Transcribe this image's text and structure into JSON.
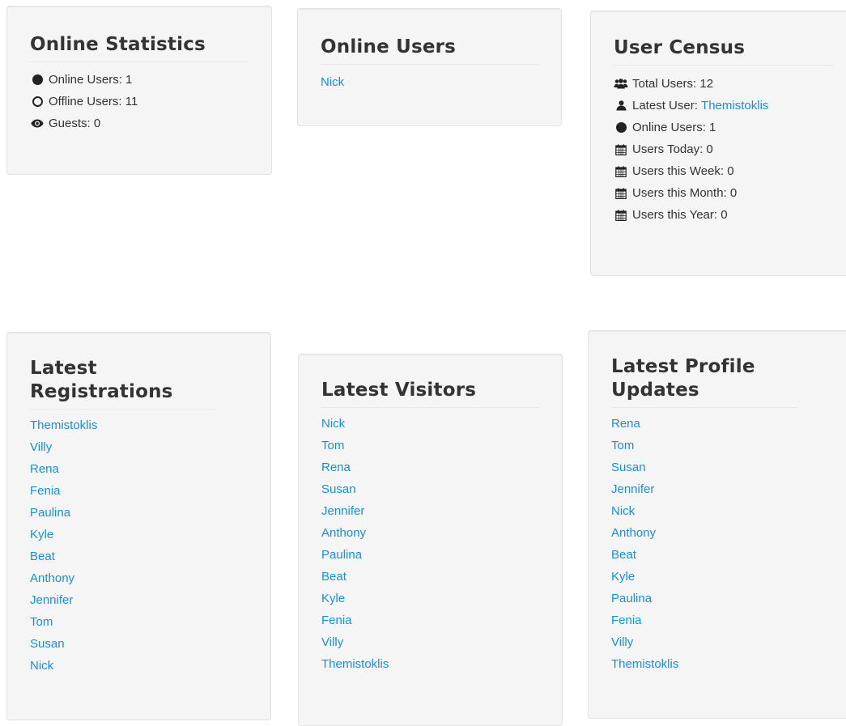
{
  "colors": {
    "link": "#1a8fd0",
    "panel_bg": "#f5f5f5",
    "panel_border": "#e3e3e3",
    "text": "#333333"
  },
  "online_statistics": {
    "title": "Online Statistics",
    "rows": [
      {
        "icon": "filled-circle-icon",
        "text": "Online Users: 1"
      },
      {
        "icon": "open-circle-icon",
        "text": "Offline Users: 11"
      },
      {
        "icon": "eye-icon",
        "text": "Guests: 0"
      }
    ]
  },
  "online_users": {
    "title": "Online Users",
    "users": [
      "Nick"
    ]
  },
  "user_census": {
    "title": "User Census",
    "total_users": "Total Users: 12",
    "latest_user_label": "Latest User: ",
    "latest_user_name": "Themistoklis",
    "online_users": "Online Users: 1",
    "users_today": "Users Today: 0",
    "users_week": "Users this Week: 0",
    "users_month": "Users this Month: 0",
    "users_year": "Users this Year: 0",
    "icons": [
      "users-icon",
      "user-icon",
      "filled-circle-icon",
      "calendar-icon"
    ]
  },
  "latest_registrations": {
    "title": "Latest Registrations",
    "users": [
      "Themistoklis",
      "Villy",
      "Rena",
      "Fenia",
      "Paulina",
      "Kyle",
      "Beat",
      "Anthony",
      "Jennifer",
      "Tom",
      "Susan",
      "Nick"
    ]
  },
  "latest_visitors": {
    "title": "Latest Visitors",
    "users": [
      "Nick",
      "Tom",
      "Rena",
      "Susan",
      "Jennifer",
      "Anthony",
      "Paulina",
      "Beat",
      "Kyle",
      "Fenia",
      "Villy",
      "Themistoklis"
    ]
  },
  "latest_profile_updates": {
    "title": "Latest Profile Updates",
    "users": [
      "Rena",
      "Tom",
      "Susan",
      "Jennifer",
      "Nick",
      "Anthony",
      "Beat",
      "Kyle",
      "Paulina",
      "Fenia",
      "Villy",
      "Themistoklis"
    ]
  }
}
